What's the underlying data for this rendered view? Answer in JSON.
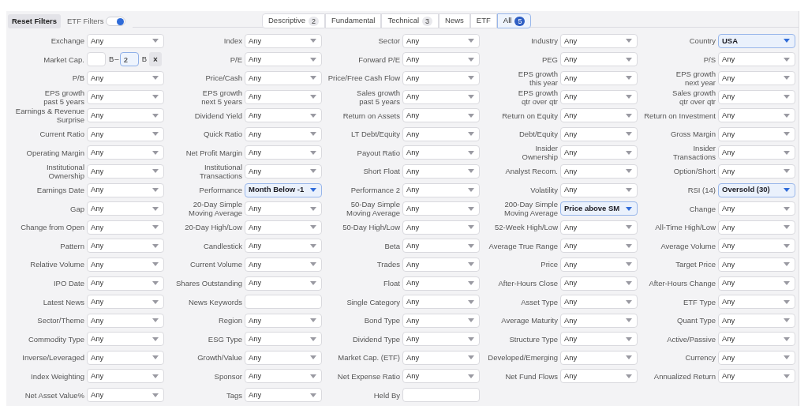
{
  "toolbar": {
    "reset_button": "Reset Filters",
    "etf_toggle": {
      "label": "ETF Filters",
      "on": true
    }
  },
  "tabs": [
    {
      "label": "Descriptive",
      "count": "2",
      "selected": false
    },
    {
      "label": "Fundamental",
      "selected": false
    },
    {
      "label": "Technical",
      "count": "3",
      "selected": false
    },
    {
      "label": "News",
      "selected": false
    },
    {
      "label": "ETF",
      "selected": false
    },
    {
      "label": "All",
      "count": "5",
      "selected": true
    }
  ],
  "rows": [
    [
      {
        "label": [
          "Exchange"
        ],
        "kind": "select",
        "value": "Any",
        "active": false
      },
      {
        "label": [
          "Index"
        ],
        "kind": "select",
        "value": "Any",
        "active": false
      },
      {
        "label": [
          "Sector"
        ],
        "kind": "select",
        "value": "Any",
        "active": false
      },
      {
        "label": [
          "Industry"
        ],
        "kind": "select",
        "value": "Any",
        "active": false
      },
      {
        "label": [
          "Country"
        ],
        "kind": "select",
        "value": "USA",
        "active": true
      }
    ],
    [
      {
        "label": [
          "Market Cap."
        ],
        "kind": "range",
        "from_unit": "B",
        "dash": "–",
        "to": "2",
        "to_unit": "B",
        "clear": "×"
      },
      {
        "label": [
          "P/E"
        ],
        "kind": "select",
        "value": "Any",
        "active": false
      },
      {
        "label": [
          "Forward P/E"
        ],
        "kind": "select",
        "value": "Any",
        "active": false
      },
      {
        "label": [
          "PEG"
        ],
        "kind": "select",
        "value": "Any",
        "active": false
      },
      {
        "label": [
          "P/S"
        ],
        "kind": "select",
        "value": "Any",
        "active": false
      }
    ],
    [
      {
        "label": [
          "P/B"
        ],
        "kind": "select",
        "value": "Any",
        "active": false
      },
      {
        "label": [
          "Price/Cash"
        ],
        "kind": "select",
        "value": "Any",
        "active": false
      },
      {
        "label": [
          "Price/Free Cash Flow"
        ],
        "kind": "select",
        "value": "Any",
        "active": false
      },
      {
        "label": [
          "EPS growth",
          "this year"
        ],
        "kind": "select",
        "value": "Any",
        "active": false
      },
      {
        "label": [
          "EPS growth",
          "next year"
        ],
        "kind": "select",
        "value": "Any",
        "active": false
      }
    ],
    [
      {
        "label": [
          "EPS growth",
          "past 5 years"
        ],
        "kind": "select",
        "value": "Any",
        "active": false
      },
      {
        "label": [
          "EPS growth",
          "next 5 years"
        ],
        "kind": "select",
        "value": "Any",
        "active": false
      },
      {
        "label": [
          "Sales growth",
          "past 5 years"
        ],
        "kind": "select",
        "value": "Any",
        "active": false
      },
      {
        "label": [
          "EPS growth",
          "qtr over qtr"
        ],
        "kind": "select",
        "value": "Any",
        "active": false
      },
      {
        "label": [
          "Sales growth",
          "qtr over qtr"
        ],
        "kind": "select",
        "value": "Any",
        "active": false
      }
    ],
    [
      {
        "label": [
          "Earnings & Revenue",
          "Surprise"
        ],
        "kind": "select",
        "value": "Any",
        "active": false
      },
      {
        "label": [
          "Dividend Yield"
        ],
        "kind": "select",
        "value": "Any",
        "active": false
      },
      {
        "label": [
          "Return on Assets"
        ],
        "kind": "select",
        "value": "Any",
        "active": false
      },
      {
        "label": [
          "Return on Equity"
        ],
        "kind": "select",
        "value": "Any",
        "active": false
      },
      {
        "label": [
          "Return on Investment"
        ],
        "kind": "select",
        "value": "Any",
        "active": false
      }
    ],
    [
      {
        "label": [
          "Current Ratio"
        ],
        "kind": "select",
        "value": "Any",
        "active": false
      },
      {
        "label": [
          "Quick Ratio"
        ],
        "kind": "select",
        "value": "Any",
        "active": false
      },
      {
        "label": [
          "LT Debt/Equity"
        ],
        "kind": "select",
        "value": "Any",
        "active": false
      },
      {
        "label": [
          "Debt/Equity"
        ],
        "kind": "select",
        "value": "Any",
        "active": false
      },
      {
        "label": [
          "Gross Margin"
        ],
        "kind": "select",
        "value": "Any",
        "active": false
      }
    ],
    [
      {
        "label": [
          "Operating Margin"
        ],
        "kind": "select",
        "value": "Any",
        "active": false
      },
      {
        "label": [
          "Net Profit Margin"
        ],
        "kind": "select",
        "value": "Any",
        "active": false
      },
      {
        "label": [
          "Payout Ratio"
        ],
        "kind": "select",
        "value": "Any",
        "active": false
      },
      {
        "label": [
          "Insider",
          "Ownership"
        ],
        "kind": "select",
        "value": "Any",
        "active": false
      },
      {
        "label": [
          "Insider",
          "Transactions"
        ],
        "kind": "select",
        "value": "Any",
        "active": false
      }
    ],
    [
      {
        "label": [
          "Institutional",
          "Ownership"
        ],
        "kind": "select",
        "value": "Any",
        "active": false
      },
      {
        "label": [
          "Institutional",
          "Transactions"
        ],
        "kind": "select",
        "value": "Any",
        "active": false
      },
      {
        "label": [
          "Short Float"
        ],
        "kind": "select",
        "value": "Any",
        "active": false
      },
      {
        "label": [
          "Analyst Recom."
        ],
        "kind": "select",
        "value": "Any",
        "active": false
      },
      {
        "label": [
          "Option/Short"
        ],
        "kind": "select",
        "value": "Any",
        "active": false
      }
    ],
    [
      {
        "label": [
          "Earnings Date"
        ],
        "kind": "select",
        "value": "Any",
        "active": false
      },
      {
        "label": [
          "Performance"
        ],
        "kind": "select",
        "value": "Month Below -1",
        "active": true
      },
      {
        "label": [
          "Performance 2"
        ],
        "kind": "select",
        "value": "Any",
        "active": false
      },
      {
        "label": [
          "Volatility"
        ],
        "kind": "select",
        "value": "Any",
        "active": false
      },
      {
        "label": [
          "RSI (14)"
        ],
        "kind": "select",
        "value": "Oversold (30)",
        "active": true
      }
    ],
    [
      {
        "label": [
          "Gap"
        ],
        "kind": "select",
        "value": "Any",
        "active": false
      },
      {
        "label": [
          "20-Day Simple",
          "Moving Average"
        ],
        "kind": "select",
        "value": "Any",
        "active": false
      },
      {
        "label": [
          "50-Day Simple",
          "Moving Average"
        ],
        "kind": "select",
        "value": "Any",
        "active": false
      },
      {
        "label": [
          "200-Day Simple",
          "Moving Average"
        ],
        "kind": "select",
        "value": "Price above SM",
        "active": true
      },
      {
        "label": [
          "Change"
        ],
        "kind": "select",
        "value": "Any",
        "active": false
      }
    ],
    [
      {
        "label": [
          "Change from Open"
        ],
        "kind": "select",
        "value": "Any",
        "active": false
      },
      {
        "label": [
          "20-Day High/Low"
        ],
        "kind": "select",
        "value": "Any",
        "active": false
      },
      {
        "label": [
          "50-Day High/Low"
        ],
        "kind": "select",
        "value": "Any",
        "active": false
      },
      {
        "label": [
          "52-Week High/Low"
        ],
        "kind": "select",
        "value": "Any",
        "active": false
      },
      {
        "label": [
          "All-Time High/Low"
        ],
        "kind": "select",
        "value": "Any",
        "active": false
      }
    ],
    [
      {
        "label": [
          "Pattern"
        ],
        "kind": "select",
        "value": "Any",
        "active": false
      },
      {
        "label": [
          "Candlestick"
        ],
        "kind": "select",
        "value": "Any",
        "active": false
      },
      {
        "label": [
          "Beta"
        ],
        "kind": "select",
        "value": "Any",
        "active": false
      },
      {
        "label": [
          "Average True Range"
        ],
        "kind": "select",
        "value": "Any",
        "active": false
      },
      {
        "label": [
          "Average Volume"
        ],
        "kind": "select",
        "value": "Any",
        "active": false
      }
    ],
    [
      {
        "label": [
          "Relative Volume"
        ],
        "kind": "select",
        "value": "Any",
        "active": false
      },
      {
        "label": [
          "Current Volume"
        ],
        "kind": "select",
        "value": "Any",
        "active": false
      },
      {
        "label": [
          "Trades"
        ],
        "kind": "select",
        "value": "Any",
        "active": false
      },
      {
        "label": [
          "Price"
        ],
        "kind": "select",
        "value": "Any",
        "active": false
      },
      {
        "label": [
          "Target Price"
        ],
        "kind": "select",
        "value": "Any",
        "active": false
      }
    ],
    [
      {
        "label": [
          "IPO Date"
        ],
        "kind": "select",
        "value": "Any",
        "active": false
      },
      {
        "label": [
          "Shares Outstanding"
        ],
        "kind": "select",
        "value": "Any",
        "active": false
      },
      {
        "label": [
          "Float"
        ],
        "kind": "select",
        "value": "Any",
        "active": false
      },
      {
        "label": [
          "After-Hours Close"
        ],
        "kind": "select",
        "value": "Any",
        "active": false
      },
      {
        "label": [
          "After-Hours Change"
        ],
        "kind": "select",
        "value": "Any",
        "active": false
      }
    ],
    [
      {
        "label": [
          "Latest News"
        ],
        "kind": "select",
        "value": "Any",
        "active": false
      },
      {
        "label": [
          "News Keywords"
        ],
        "kind": "text"
      },
      {
        "label": [
          "Single Category"
        ],
        "kind": "select",
        "value": "Any",
        "active": false
      },
      {
        "label": [
          "Asset Type"
        ],
        "kind": "select",
        "value": "Any",
        "active": false
      },
      {
        "label": [
          "ETF Type"
        ],
        "kind": "select",
        "value": "Any",
        "active": false
      }
    ],
    [
      {
        "label": [
          "Sector/Theme"
        ],
        "kind": "select",
        "value": "Any",
        "active": false
      },
      {
        "label": [
          "Region"
        ],
        "kind": "select",
        "value": "Any",
        "active": false
      },
      {
        "label": [
          "Bond Type"
        ],
        "kind": "select",
        "value": "Any",
        "active": false
      },
      {
        "label": [
          "Average Maturity"
        ],
        "kind": "select",
        "value": "Any",
        "active": false
      },
      {
        "label": [
          "Quant Type"
        ],
        "kind": "select",
        "value": "Any",
        "active": false
      }
    ],
    [
      {
        "label": [
          "Commodity Type"
        ],
        "kind": "select",
        "value": "Any",
        "active": false
      },
      {
        "label": [
          "ESG Type"
        ],
        "kind": "select",
        "value": "Any",
        "active": false
      },
      {
        "label": [
          "Dividend Type"
        ],
        "kind": "select",
        "value": "Any",
        "active": false
      },
      {
        "label": [
          "Structure Type"
        ],
        "kind": "select",
        "value": "Any",
        "active": false
      },
      {
        "label": [
          "Active/Passive"
        ],
        "kind": "select",
        "value": "Any",
        "active": false
      }
    ],
    [
      {
        "label": [
          "Inverse/Leveraged"
        ],
        "kind": "select",
        "value": "Any",
        "active": false
      },
      {
        "label": [
          "Growth/Value"
        ],
        "kind": "select",
        "value": "Any",
        "active": false
      },
      {
        "label": [
          "Market Cap. (ETF)"
        ],
        "kind": "select",
        "value": "Any",
        "active": false
      },
      {
        "label": [
          "Developed/Emerging"
        ],
        "kind": "select",
        "value": "Any",
        "active": false
      },
      {
        "label": [
          "Currency"
        ],
        "kind": "select",
        "value": "Any",
        "active": false
      }
    ],
    [
      {
        "label": [
          "Index Weighting"
        ],
        "kind": "select",
        "value": "Any",
        "active": false
      },
      {
        "label": [
          "Sponsor"
        ],
        "kind": "select",
        "value": "Any",
        "active": false
      },
      {
        "label": [
          "Net Expense Ratio"
        ],
        "kind": "select",
        "value": "Any",
        "active": false
      },
      {
        "label": [
          "Net Fund Flows"
        ],
        "kind": "select",
        "value": "Any",
        "active": false
      },
      {
        "label": [
          "Annualized Return"
        ],
        "kind": "select",
        "value": "Any",
        "active": false
      }
    ],
    [
      {
        "label": [
          "Net Asset Value%"
        ],
        "kind": "select",
        "value": "Any",
        "active": false
      },
      {
        "label": [
          "Tags"
        ],
        "kind": "select",
        "value": "Any",
        "active": false
      },
      {
        "label": [
          "Held By"
        ],
        "kind": "text"
      }
    ]
  ]
}
